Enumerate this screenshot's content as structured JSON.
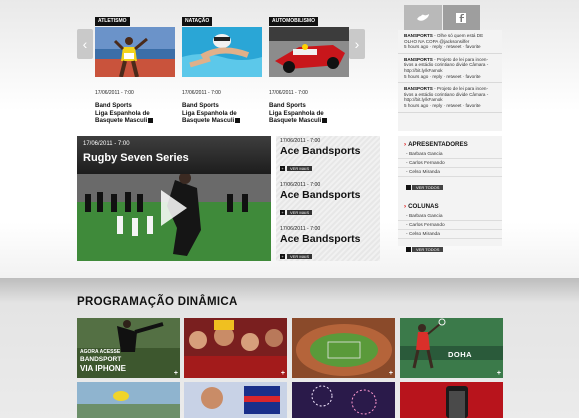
{
  "carousel": {
    "cards": [
      {
        "tag": "ATLETISMO",
        "date": "17/06/2011 - 7:00",
        "title_lines": [
          "Band Sports",
          "Liga Espanhola de",
          "Basquete Masculi"
        ]
      },
      {
        "tag": "NATAÇÃO",
        "date": "17/06/2011 - 7:00",
        "title_lines": [
          "Band Sports",
          "Liga Espanhola de",
          "Basquete Masculi"
        ]
      },
      {
        "tag": "AUTOMOBILISMO",
        "date": "17/06/2011 - 7:00",
        "title_lines": [
          "Band Sports",
          "Liga Espanhola de",
          "Basquete Masculi"
        ]
      }
    ],
    "prev_icon": "chevron-left-icon",
    "next_icon": "chevron-right-icon"
  },
  "twitter": {
    "tweets": [
      {
        "user": "BANSPORTS",
        "text": "- Olhe só quem está DE OLHO NA COPA @jacksonsilfer",
        "meta": "5 hours ago · reply · retweet · favorite"
      },
      {
        "user": "BANSPORTS",
        "text": "- Projeto de lei para incen-tivos a estádio corintiano divide Câmara - http://bit.ly/kFamok",
        "meta": "5 hours ago · reply · retweet · favorite"
      },
      {
        "user": "BANSPORTS",
        "text": "- Projeto de lei para incen-tivos a estádio corintiano divide Câmara - http://bit.ly/kFamok",
        "meta": "5 hours ago · reply · retweet · favorite"
      }
    ]
  },
  "video": {
    "date": "17/06/2011 - 7:00",
    "title": "Rugby Seven Series",
    "list": [
      {
        "date": "17/06/2011 - 7:00",
        "title": "Ace Bandsports",
        "more": "VER MAIS"
      },
      {
        "date": "17/06/2011 - 7:00",
        "title": "Ace Bandsports",
        "more": "VER MAIS"
      },
      {
        "date": "17/06/2011 - 7:00",
        "title": "Ace Bandsports",
        "more": "VER MAIS"
      }
    ]
  },
  "sidebar": {
    "apresentadores_title": "APRESENTADORES",
    "apresentadores": [
      "Barbara Gancia",
      "Carlos Fernando",
      "Celso Miranda"
    ],
    "colunas_title": "COLUNAS",
    "colunas": [
      "Barbara Gancia",
      "Carlos Fernando",
      "Celso Miranda"
    ],
    "see_all": "VER TODOS"
  },
  "programacao": {
    "title": "PROGRAMAÇÃO DINÂMICA",
    "tile1_small": "AGORA ACESSE",
    "tile1_mid": "BANDSPORT",
    "tile1_big": "VIA IPHONE",
    "doha": "DOHA"
  }
}
